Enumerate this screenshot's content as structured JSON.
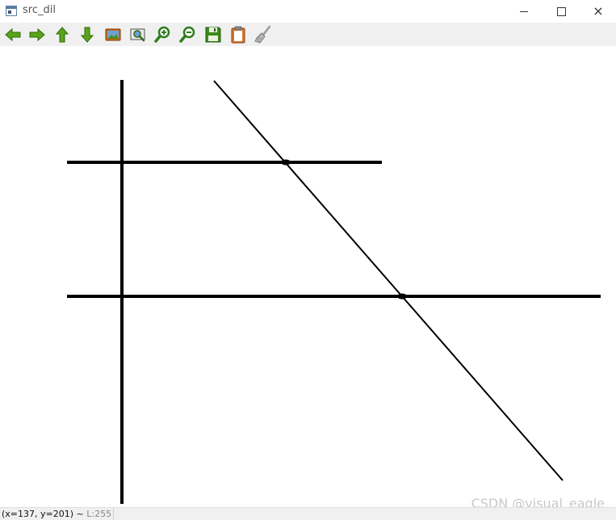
{
  "window": {
    "title": "src_dil",
    "controls": {
      "minimize": "minimize",
      "maximize": "maximize",
      "close": "×"
    }
  },
  "toolbar": {
    "buttons": [
      {
        "icon": "arrow-left-icon",
        "color": "#4e9a06"
      },
      {
        "icon": "arrow-right-icon",
        "color": "#4e9a06"
      },
      {
        "icon": "arrow-up-icon",
        "color": "#4e9a06"
      },
      {
        "icon": "arrow-down-icon",
        "color": "#4e9a06"
      },
      {
        "icon": "image-icon",
        "color": "#c05a1a"
      },
      {
        "icon": "zoom-fit-icon",
        "color": "#2e7d32"
      },
      {
        "icon": "zoom-in-icon",
        "color": "#2e7d32"
      },
      {
        "icon": "zoom-out-icon",
        "color": "#2e7d32"
      },
      {
        "icon": "save-icon",
        "color": "#2e7d32"
      },
      {
        "icon": "clipboard-icon",
        "color": "#c05a1a"
      },
      {
        "icon": "properties-brush-icon",
        "color": "#9a9a9a"
      }
    ]
  },
  "status": {
    "coordinates": "(x=137, y=201) ~ ",
    "level": "L:255"
  },
  "watermark": "CSDN @visual_eagle",
  "colors": {
    "line": "#000000",
    "background": "#ffffff",
    "toolbar_bg": "#f0f0f0"
  }
}
